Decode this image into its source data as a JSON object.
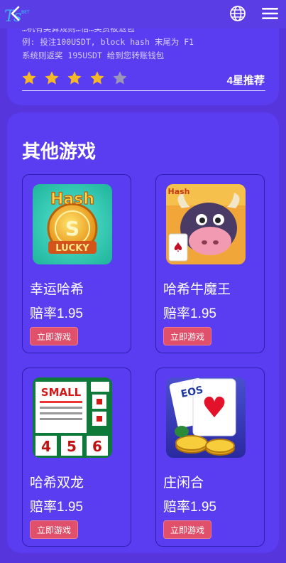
{
  "header": {
    "back_icon": "chevron-left-icon",
    "globe_icon": "globe-icon",
    "menu_icon": "hamburger-menu-icon"
  },
  "rules": {
    "line1": "…机有奖算规则…倍…奖赏被退包",
    "line2": "例: 投注100USDT, block hash 末尾为 F1",
    "line3": "系统则返奖 195USDT 给到您转账钱包"
  },
  "rating": {
    "filled_stars": 4,
    "total_stars": 5,
    "label": "4星推荐",
    "star_color": "#f5b826",
    "empty_star_color": "#9b95b8"
  },
  "section": {
    "title": "其他游戏"
  },
  "games": [
    {
      "name": "幸运哈希",
      "odds": "赔率1.95",
      "button": "立即游戏",
      "thumb_text_top": "Hash",
      "thumb_text_bottom": "LUCKY"
    },
    {
      "name": "哈希牛魔王",
      "odds": "赔率1.95",
      "button": "立即游戏",
      "thumb_text_top": "Hash",
      "thumb_text_bottom": ""
    },
    {
      "name": "哈希双龙",
      "odds": "赔率1.95",
      "button": "立即游戏",
      "thumb_text_top": "SMALL",
      "thumb_text_bottom": "4 5 6"
    },
    {
      "name": "庄闲合",
      "odds": "赔率1.95",
      "button": "立即游戏",
      "thumb_text_top": "EOS",
      "thumb_text_bottom": ""
    }
  ],
  "colors": {
    "background": "#5635dd",
    "card": "#5a3df0",
    "button": "#e1506a"
  }
}
